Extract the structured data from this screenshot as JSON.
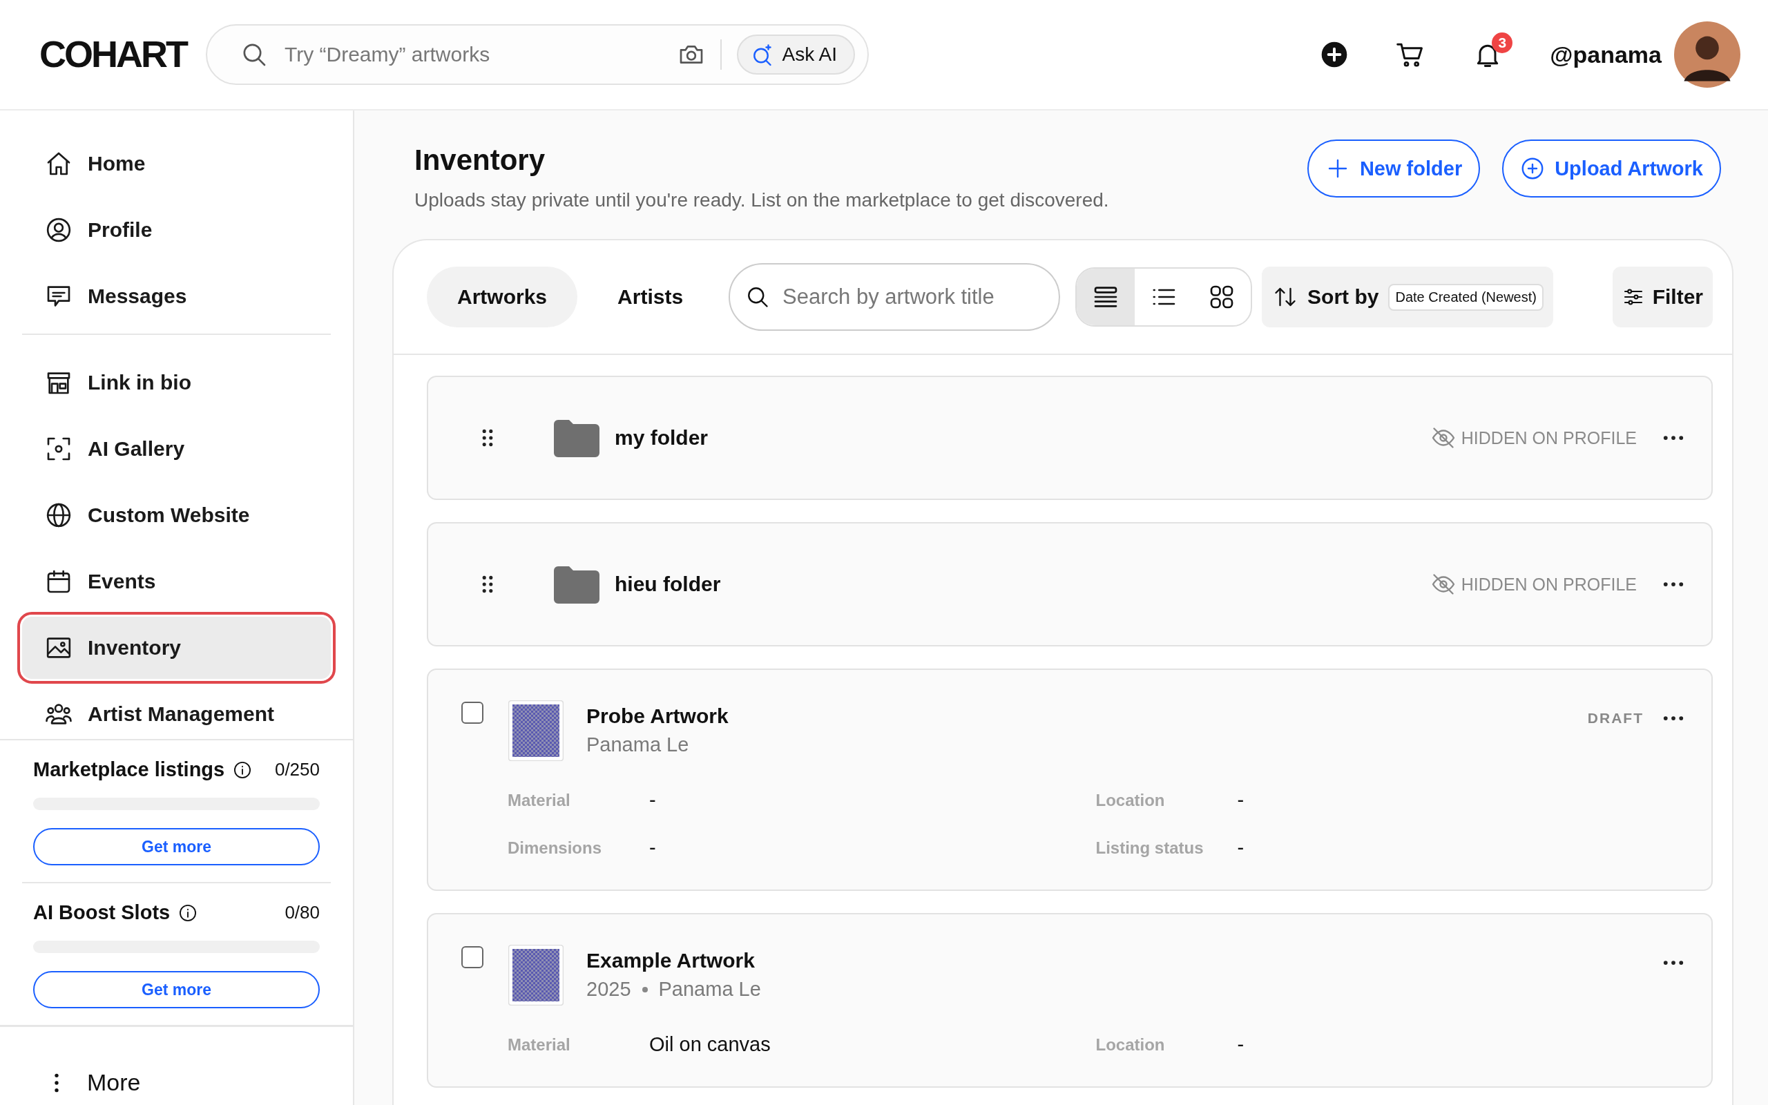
{
  "header": {
    "logo": "COHART",
    "search": {
      "placeholder": "Try “Dreamy” artworks"
    },
    "ask_ai": "Ask AI",
    "notifications_badge": "3",
    "username": "@panama"
  },
  "sidebar": {
    "nav_groups": [
      [
        {
          "label": "Home",
          "selected": false
        },
        {
          "label": "Profile",
          "selected": false
        },
        {
          "label": "Messages",
          "selected": false
        }
      ],
      [
        {
          "label": "Link in bio",
          "selected": false
        },
        {
          "label": "AI Gallery",
          "selected": false
        },
        {
          "label": "Custom Website",
          "selected": false
        },
        {
          "label": "Events",
          "selected": false
        },
        {
          "label": "Inventory",
          "selected": true
        },
        {
          "label": "Artist Management",
          "selected": false
        }
      ]
    ],
    "quotas": [
      {
        "title": "Marketplace listings",
        "count": "0/250",
        "level": 0,
        "button": "Get more"
      },
      {
        "title": "AI Boost Slots",
        "count": "0/80",
        "level": 0,
        "button": "Get more"
      }
    ],
    "more": "More"
  },
  "page": {
    "title": "Inventory",
    "subtitle": "Uploads stay private until you're ready. List on the marketplace to get discovered.",
    "buttons": [
      "New folder",
      "Upload Artwork"
    ]
  },
  "toolbar": {
    "tabs": [
      {
        "label": "Artworks",
        "selected": true
      },
      {
        "label": "Artists",
        "selected": false
      }
    ],
    "search": {
      "placeholder": "Search by artwork title"
    },
    "views": [
      {
        "kind": "rows",
        "selected": true
      },
      {
        "kind": "list",
        "selected": false
      },
      {
        "kind": "grid",
        "selected": false
      }
    ],
    "sort_label": "Sort by",
    "sort_value": "Date Created (Newest)",
    "filter": "Filter"
  },
  "items": [
    {
      "kind": "folder",
      "name": "my folder",
      "visibility": "HIDDEN ON PROFILE"
    },
    {
      "kind": "folder",
      "name": "hieu folder",
      "visibility": "HIDDEN ON PROFILE"
    },
    {
      "kind": "artwork",
      "title": "Probe Artwork",
      "artist": "Panama Le",
      "status": "DRAFT",
      "checked": false,
      "fields": [
        {
          "label": "Material",
          "value": "-"
        },
        {
          "label": "Location",
          "value": "-"
        },
        {
          "label": "Dimensions",
          "value": "-"
        },
        {
          "label": "Listing status",
          "value": "-"
        }
      ]
    },
    {
      "kind": "artwork",
      "title": "Example Artwork",
      "year": "2025",
      "artist": "Panama Le",
      "checked": false,
      "fields": [
        {
          "label": "Material",
          "value": "Oil on canvas"
        },
        {
          "label": "Location",
          "value": "-"
        }
      ]
    }
  ]
}
